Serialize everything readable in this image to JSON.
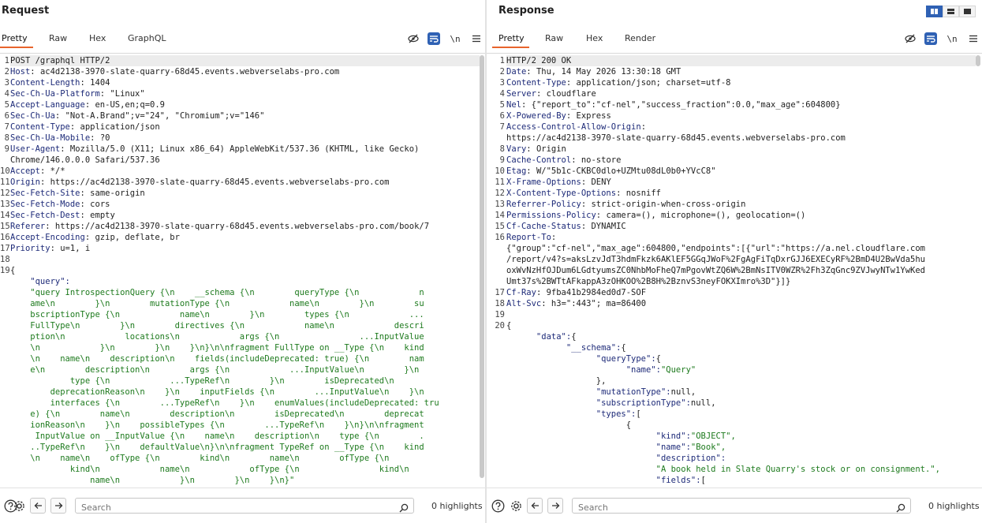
{
  "request": {
    "title": "Request",
    "tabs": [
      {
        "label": "Pretty",
        "active": true
      },
      {
        "label": "Raw",
        "active": false
      },
      {
        "label": "Hex",
        "active": false
      },
      {
        "label": "GraphQL",
        "active": false
      }
    ],
    "newline_label": "\\n",
    "lines": [
      {
        "no": "1",
        "k": "",
        "v": "POST /graphql HTTP/2"
      },
      {
        "no": "2",
        "k": "Host",
        "v": "ac4d2138-3970-slate-quarry-68d45.events.webverselabs-pro.com"
      },
      {
        "no": "3",
        "k": "Content-Length",
        "v": "1404"
      },
      {
        "no": "4",
        "k": "Sec-Ch-Ua-Platform",
        "v": "\"Linux\""
      },
      {
        "no": "5",
        "k": "Accept-Language",
        "v": "en-US,en;q=0.9"
      },
      {
        "no": "6",
        "k": "Sec-Ch-Ua",
        "v": "\"Not-A.Brand\";v=\"24\", \"Chromium\";v=\"146\""
      },
      {
        "no": "7",
        "k": "Content-Type",
        "v": "application/json"
      },
      {
        "no": "8",
        "k": "Sec-Ch-Ua-Mobile",
        "v": "?0"
      },
      {
        "no": "9",
        "k": "User-Agent",
        "v": "Mozilla/5.0 (X11; Linux x86_64) AppleWebKit/537.36 (KHTML, like Gecko)"
      },
      {
        "no": "",
        "k": "",
        "v": "Chrome/146.0.0.0 Safari/537.36"
      },
      {
        "no": "10",
        "k": "Accept",
        "v": "*/*"
      },
      {
        "no": "11",
        "k": "Origin",
        "v": "https://ac4d2138-3970-slate-quarry-68d45.events.webverselabs-pro.com"
      },
      {
        "no": "12",
        "k": "Sec-Fetch-Site",
        "v": "same-origin"
      },
      {
        "no": "13",
        "k": "Sec-Fetch-Mode",
        "v": "cors"
      },
      {
        "no": "14",
        "k": "Sec-Fetch-Dest",
        "v": "empty"
      },
      {
        "no": "15",
        "k": "Referer",
        "v": "https://ac4d2138-3970-slate-quarry-68d45.events.webverselabs-pro.com/book/7"
      },
      {
        "no": "16",
        "k": "Accept-Encoding",
        "v": "gzip, deflate, br"
      },
      {
        "no": "17",
        "k": "Priority",
        "v": "u=1, i"
      },
      {
        "no": "18",
        "k": "",
        "v": ""
      },
      {
        "no": "19",
        "k": "",
        "v": "{"
      },
      {
        "no": "",
        "k": "    \"query\":",
        "v": ""
      },
      {
        "no": "",
        "s": "    \"query IntrospectionQuery {\\n    __schema {\\n        queryType {\\n            n"
      },
      {
        "no": "",
        "s": "    ame\\n        }\\n        mutationType {\\n            name\\n        }\\n        su"
      },
      {
        "no": "",
        "s": "    bscriptionType {\\n            name\\n        }\\n        types {\\n            ..."
      },
      {
        "no": "",
        "s": "    FullType\\n        }\\n        directives {\\n            name\\n            descri"
      },
      {
        "no": "",
        "s": "    ption\\n            locations\\n            args {\\n                ...InputValue"
      },
      {
        "no": "",
        "s": "    \\n            }\\n        }\\n    }\\n}\\n\\nfragment FullType on __Type {\\n    kind"
      },
      {
        "no": "",
        "s": "    \\n    name\\n    description\\n    fields(includeDeprecated: true) {\\n        nam"
      },
      {
        "no": "",
        "s": "    e\\n        description\\n        args {\\n            ...InputValue\\n        }\\n"
      },
      {
        "no": "",
        "s": "            type {\\n            ...TypeRef\\n        }\\n        isDeprecated\\n"
      },
      {
        "no": "",
        "s": "        deprecationReason\\n    }\\n    inputFields {\\n        ...InputValue\\n    }\\n"
      },
      {
        "no": "",
        "s": "        interfaces {\\n        ...TypeRef\\n    }\\n    enumValues(includeDeprecated: tru"
      },
      {
        "no": "",
        "s": "    e) {\\n        name\\n        description\\n        isDeprecated\\n        deprecat"
      },
      {
        "no": "",
        "s": "    ionReason\\n    }\\n    possibleTypes {\\n        ...TypeRef\\n    }\\n}\\n\\nfragment"
      },
      {
        "no": "",
        "s": "     InputValue on __InputValue {\\n    name\\n    description\\n    type {\\n        ."
      },
      {
        "no": "",
        "s": "    ..TypeRef\\n    }\\n    defaultValue\\n}\\n\\nfragment TypeRef on __Type {\\n    kind"
      },
      {
        "no": "",
        "s": "    \\n    name\\n    ofType {\\n        kind\\n        name\\n        ofType {\\n"
      },
      {
        "no": "",
        "s": "            kind\\n            name\\n            ofType {\\n                kind\\n"
      },
      {
        "no": "",
        "s": "                name\\n            }\\n        }\\n    }\\n}\""
      },
      {
        "no": "",
        "k": "",
        "v": "}"
      }
    ],
    "search": {
      "placeholder": "Search",
      "highlights": "0 highlights"
    }
  },
  "response": {
    "title": "Response",
    "tabs": [
      {
        "label": "Pretty",
        "active": true
      },
      {
        "label": "Raw",
        "active": false
      },
      {
        "label": "Hex",
        "active": false
      },
      {
        "label": "Render",
        "active": false
      }
    ],
    "newline_label": "\\n",
    "lines": [
      {
        "no": "1",
        "k": "",
        "v": "HTTP/2 200 OK"
      },
      {
        "no": "2",
        "k": "Date",
        "v": "Thu, 14 May 2026 13:30:18 GMT"
      },
      {
        "no": "3",
        "k": "Content-Type",
        "v": "application/json; charset=utf-8"
      },
      {
        "no": "4",
        "k": "Server",
        "v": "cloudflare"
      },
      {
        "no": "5",
        "k": "Nel",
        "v": "{\"report_to\":\"cf-nel\",\"success_fraction\":0.0,\"max_age\":604800}"
      },
      {
        "no": "6",
        "k": "X-Powered-By",
        "v": "Express"
      },
      {
        "no": "7",
        "k": "Access-Control-Allow-Origin",
        "v": ""
      },
      {
        "no": "",
        "k": "",
        "v": "https://ac4d2138-3970-slate-quarry-68d45.events.webverselabs-pro.com"
      },
      {
        "no": "8",
        "k": "Vary",
        "v": "Origin"
      },
      {
        "no": "9",
        "k": "Cache-Control",
        "v": "no-store"
      },
      {
        "no": "10",
        "k": "Etag",
        "v": "W/\"5b1c-CKBC0dlo+UZMtu08dL0b0+YVcC8\""
      },
      {
        "no": "11",
        "k": "X-Frame-Options",
        "v": "DENY"
      },
      {
        "no": "12",
        "k": "X-Content-Type-Options",
        "v": "nosniff"
      },
      {
        "no": "13",
        "k": "Referrer-Policy",
        "v": "strict-origin-when-cross-origin"
      },
      {
        "no": "14",
        "k": "Permissions-Policy",
        "v": "camera=(), microphone=(), geolocation=()"
      },
      {
        "no": "15",
        "k": "Cf-Cache-Status",
        "v": "DYNAMIC"
      },
      {
        "no": "16",
        "k": "Report-To",
        "v": ""
      },
      {
        "no": "",
        "k": "",
        "v": "{\"group\":\"cf-nel\",\"max_age\":604800,\"endpoints\":[{\"url\":\"https://a.nel.cloudflare.com"
      },
      {
        "no": "",
        "k": "",
        "v": "/report/v4?s=aksLzvJdT3hdmFkzk6AKlEF5GGqJWoF%2FgAgFiTqDxrGJJ6EXECyRF%2BmD4U2BwVda5hu"
      },
      {
        "no": "",
        "k": "",
        "v": "oxWvNzHfOJDum6LGdtyumsZC0NhbMoFheQ7mPgovWtZQ6W%2BmNsITV0WZR%2Fh3ZqGnc9ZVJwyNTw1YwKed"
      },
      {
        "no": "",
        "k": "",
        "v": "Umt37s%2BWTtAFkappA3zOHKOO%2B8H%2BznvS3neyFOKXImro%3D\"}]}"
      },
      {
        "no": "17",
        "k": "Cf-Ray",
        "v": "9fba41b2984ed0d7-SOF"
      },
      {
        "no": "18",
        "k": "Alt-Svc",
        "v": "h3=\":443\"; ma=86400"
      },
      {
        "no": "19",
        "k": "",
        "v": ""
      },
      {
        "no": "20",
        "k": "",
        "v": "{"
      },
      {
        "no": "",
        "k": "      \"data\":",
        "v": "{"
      },
      {
        "no": "",
        "k": "            \"__schema\":",
        "v": "{"
      },
      {
        "no": "",
        "k": "                  \"queryType\":",
        "v": "{"
      },
      {
        "no": "",
        "k": "                        \"name\":",
        "s": "\"Query\""
      },
      {
        "no": "",
        "k": "",
        "v": "                  },"
      },
      {
        "no": "",
        "k": "                  \"mutationType\":",
        "v": "null,"
      },
      {
        "no": "",
        "k": "                  \"subscriptionType\":",
        "v": "null,"
      },
      {
        "no": "",
        "k": "                  \"types\":",
        "v": "["
      },
      {
        "no": "",
        "k": "",
        "v": "                        {"
      },
      {
        "no": "",
        "k": "                              \"kind\":",
        "s": "\"OBJECT\","
      },
      {
        "no": "",
        "k": "                              \"name\":",
        "s": "\"Book\","
      },
      {
        "no": "",
        "k": "                              \"description\":",
        "v": ""
      },
      {
        "no": "",
        "k": "",
        "s": "                              \"A book held in Slate Quarry's stock or on consignment.\","
      },
      {
        "no": "",
        "k": "                              \"fields\":",
        "v": "["
      },
      {
        "no": "",
        "k": "",
        "v": "                                    {"
      }
    ],
    "search": {
      "placeholder": "Search",
      "highlights": "0 highlights"
    }
  }
}
